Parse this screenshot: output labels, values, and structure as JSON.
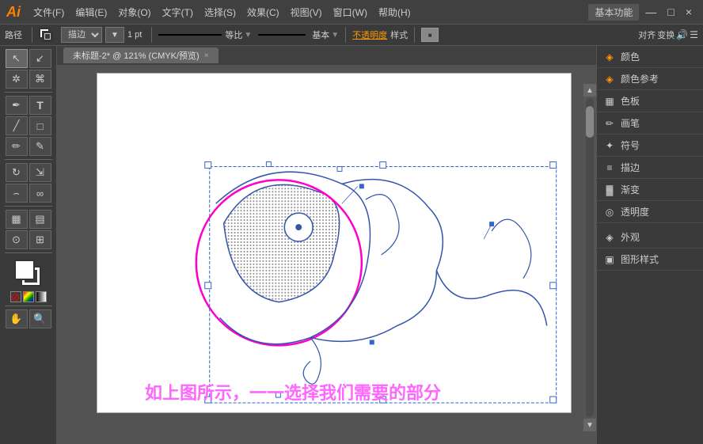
{
  "app": {
    "logo": "Ai",
    "title": "未标题-2* @ 121% (CMYK/预览)",
    "tab_close": "×",
    "workspace": "基本功能",
    "win_btns": [
      "—",
      "□",
      "×"
    ]
  },
  "menu": {
    "items": [
      "文件(F)",
      "编辑(E)",
      "对象(O)",
      "文字(T)",
      "选择(S)",
      "效果(C)",
      "视图(V)",
      "窗口(W)",
      "帮助(H)"
    ]
  },
  "toolbar": {
    "path_label": "路径",
    "stroke_label": "描边",
    "size_value": "1 pt",
    "ratio_label": "等比",
    "base_label": "基本",
    "opacity_label": "不透明度",
    "style_label": "样式",
    "align_label": "对齐",
    "transform_label": "变换"
  },
  "right_panel": {
    "items": [
      {
        "icon": "◈",
        "label": "颜色"
      },
      {
        "icon": "◈",
        "label": "颜色参考"
      },
      {
        "icon": "▦",
        "label": "色板"
      },
      {
        "icon": "✏",
        "label": "画笔"
      },
      {
        "icon": "✦",
        "label": "符号"
      },
      {
        "icon": "—",
        "label": "描边"
      },
      {
        "icon": "▓",
        "label": "渐变"
      },
      {
        "icon": "◎",
        "label": "透明度"
      },
      {
        "icon": "◈",
        "label": "外观"
      },
      {
        "icon": "▣",
        "label": "图形样式"
      }
    ]
  },
  "caption": {
    "text": "如上图所示，一一选择我们需要的部分"
  },
  "colors": {
    "accent_pink": "#FF00FF",
    "accent_blue": "#3366CC",
    "caption_color": "#FF66FF",
    "bg": "#535353"
  }
}
